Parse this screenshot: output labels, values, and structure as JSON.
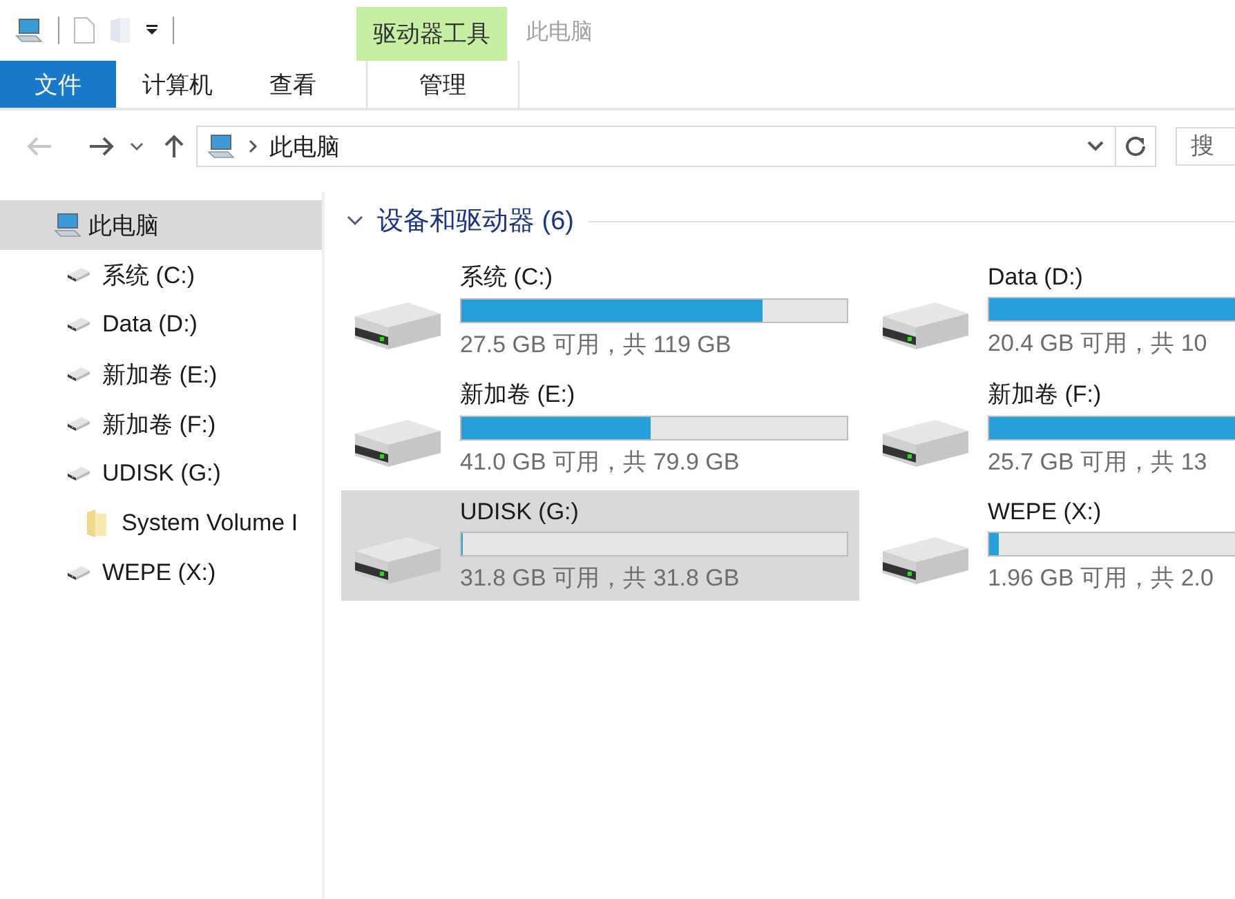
{
  "ribbon": {
    "contextual_group": "驱动器工具",
    "window_title": "此电脑",
    "tabs": [
      {
        "label": "文件",
        "kind": "file",
        "selected": false
      },
      {
        "label": "计算机",
        "kind": "normal",
        "selected": false
      },
      {
        "label": "查看",
        "kind": "normal",
        "selected": false
      },
      {
        "label": "管理",
        "kind": "contextual",
        "selected": false
      }
    ]
  },
  "address_bar": {
    "path": [
      "此电脑"
    ]
  },
  "search": {
    "placeholder": "搜"
  },
  "navigation_pane": {
    "items": [
      {
        "label": "此电脑",
        "kind": "computer",
        "selected": true,
        "children": [
          {
            "label": "系统 (C:)",
            "kind": "drive",
            "selected": false
          },
          {
            "label": "Data (D:)",
            "kind": "drive",
            "selected": false
          },
          {
            "label": "新加卷 (E:)",
            "kind": "drive",
            "selected": false
          },
          {
            "label": "新加卷 (F:)",
            "kind": "drive",
            "selected": false
          },
          {
            "label": "UDISK (G:)",
            "kind": "drive",
            "selected": false,
            "children": [
              {
                "label": "System Volume I",
                "kind": "folder",
                "selected": false
              }
            ]
          },
          {
            "label": "WEPE (X:)",
            "kind": "drive",
            "selected": false
          }
        ]
      }
    ]
  },
  "content": {
    "group_title": "设备和驱动器 (6)",
    "expanded": true,
    "drives": [
      {
        "name": "系统 (C:)",
        "space": "27.5 GB 可用，共 119 GB",
        "level": 0.78,
        "selected": false
      },
      {
        "name": "Data (D:)",
        "space": "20.4 GB 可用，共 10",
        "level": 1,
        "selected": false
      },
      {
        "name": "新加卷 (E:)",
        "space": "41.0 GB 可用，共 79.9 GB",
        "level": 0.49,
        "selected": false
      },
      {
        "name": "新加卷 (F:)",
        "space": "25.7 GB 可用，共 13",
        "level": 1,
        "selected": false
      },
      {
        "name": "UDISK (G:)",
        "space": "31.8 GB 可用，共 31.8 GB",
        "level": 0,
        "selected": true
      },
      {
        "name": "WEPE (X:)",
        "space": "1.96 GB 可用，共 2.0",
        "level": 0.04,
        "selected": false
      }
    ]
  }
}
